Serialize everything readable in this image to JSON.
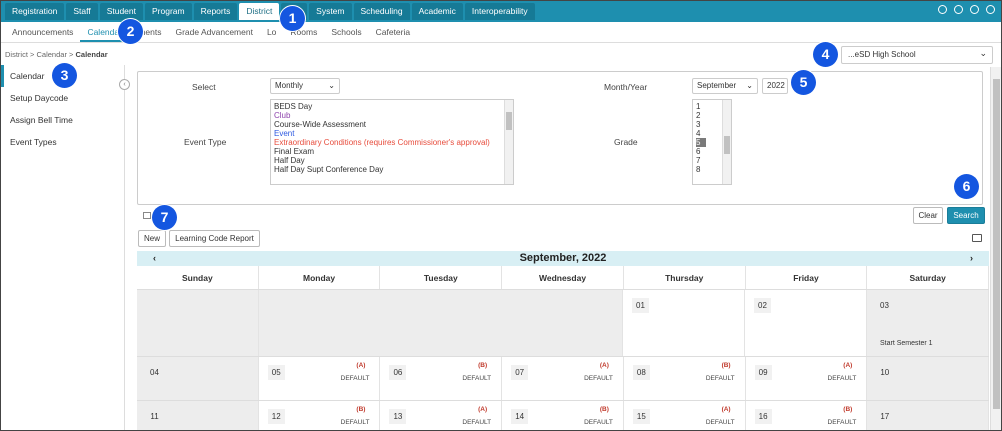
{
  "topnav": {
    "tabs": [
      "Registration",
      "Staff",
      "Student",
      "Program",
      "Reports",
      "District",
      "SD",
      "System",
      "Scheduling",
      "Academic",
      "Interoperability"
    ],
    "active": "District"
  },
  "subnav": {
    "tabs": [
      "Announcements",
      "Calendar",
      "tments",
      "Grade Advancement",
      "Lo",
      "Rooms",
      "Schools",
      "Cafeteria"
    ],
    "active": "Calendar"
  },
  "breadcrumb": {
    "a": "District",
    "b": "Calendar",
    "c": "Calendar",
    "sep": ">"
  },
  "sidebar": {
    "items": [
      "Calendar",
      "Setup Daycode",
      "Assign Bell Time",
      "Event Types"
    ],
    "active": "Calendar"
  },
  "school_select": "...eSD High School",
  "filter": {
    "select_label": "Select",
    "select_value": "Monthly",
    "monthyear_label": "Month/Year",
    "month_value": "September",
    "year_value": "2022",
    "event_type_label": "Event Type",
    "event_types": [
      {
        "t": "BEDS Day",
        "c": "#333"
      },
      {
        "t": "Club",
        "c": "#8e44ad"
      },
      {
        "t": "Course-Wide Assessment",
        "c": "#333"
      },
      {
        "t": "Event",
        "c": "#2e5ae0"
      },
      {
        "t": "Extraordinary Conditions (requires Commissioner's approval)",
        "c": "#e74c3c"
      },
      {
        "t": "Final Exam",
        "c": "#333"
      },
      {
        "t": "Half Day",
        "c": "#333"
      },
      {
        "t": "Half Day Supt Conference Day",
        "c": "#333"
      }
    ],
    "grade_label": "Grade",
    "grades": [
      "1",
      "2",
      "3",
      "4",
      "5",
      "6",
      "7",
      "8"
    ],
    "grade_selected": "5"
  },
  "buttons": {
    "clear": "Clear",
    "search": "Search",
    "new": "New",
    "report": "Learning Code Report"
  },
  "calendar": {
    "title": "September, 2022",
    "prev": "‹",
    "next": "›",
    "days": [
      "Sunday",
      "Monday",
      "Tuesday",
      "Wednesday",
      "Thursday",
      "Friday",
      "Saturday"
    ],
    "weeks": [
      [
        {
          "d": "",
          "g": true
        },
        {
          "d": "",
          "g": true,
          "span": true
        },
        {
          "d": "",
          "g": true,
          "skip": true
        },
        {
          "d": "",
          "g": true,
          "skip": true
        },
        {
          "d": "01"
        },
        {
          "d": "02"
        },
        {
          "d": "03",
          "g": true,
          "evt": "Start Semester 1"
        }
      ],
      [
        {
          "d": "04",
          "g": true
        },
        {
          "d": "05",
          "r": "(A)",
          "df": "DEFAULT"
        },
        {
          "d": "06",
          "r": "(B)",
          "df": "DEFAULT"
        },
        {
          "d": "07",
          "r": "(A)",
          "df": "DEFAULT"
        },
        {
          "d": "08",
          "r": "(B)",
          "df": "DEFAULT"
        },
        {
          "d": "09",
          "r": "(A)",
          "df": "DEFAULT"
        },
        {
          "d": "10",
          "g": true
        }
      ],
      [
        {
          "d": "11",
          "g": true
        },
        {
          "d": "12",
          "r": "(B)",
          "df": "DEFAULT"
        },
        {
          "d": "13",
          "r": "(A)",
          "df": "DEFAULT"
        },
        {
          "d": "14",
          "r": "(B)",
          "df": "DEFAULT"
        },
        {
          "d": "15",
          "r": "(A)",
          "df": "DEFAULT"
        },
        {
          "d": "16",
          "r": "(B)",
          "df": "DEFAULT"
        },
        {
          "d": "17",
          "g": true
        }
      ]
    ]
  },
  "callouts": [
    "1",
    "2",
    "3",
    "4",
    "5",
    "6",
    "7"
  ],
  "colors": {
    "accent": "#1e8faf",
    "callout": "#1456e0"
  }
}
